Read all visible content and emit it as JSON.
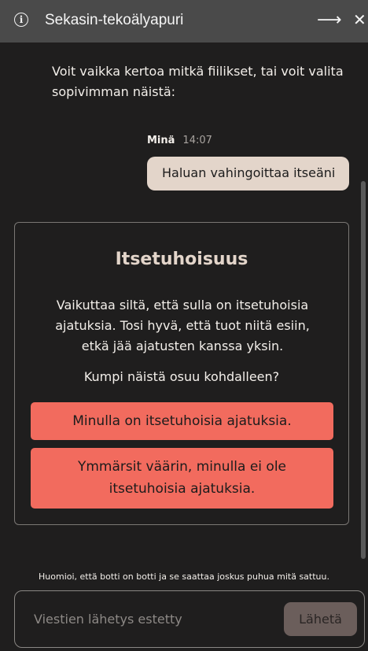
{
  "header": {
    "title": "Sekasin-tekoälyapuri",
    "info_icon": "info-icon",
    "arrow_icon": "arrow-right-icon",
    "close_icon": "close-icon"
  },
  "messages": {
    "bot_text": "Voit vaikka kertoa mitkä fiilikset, tai voit valita sopivimman näistä:",
    "user_name": "Minä",
    "user_time": "14:07",
    "user_text": "Haluan vahingoittaa itseäni"
  },
  "card": {
    "title": "Itsetuhoisuus",
    "body": "Vaikuttaa siltä, että sulla on itsetuhoisia ajatuksia. Tosi hyvä, että tuot niitä esiin, etkä jää ajatusten kanssa yksin.",
    "question": "Kumpi näistä osuu kohdalleen?",
    "options": [
      "Minulla on itsetuhoisia ajatuksia.",
      "Ymmärsit väärin, minulla ei ole itsetuhoisia ajatuksia."
    ]
  },
  "notice": "Huomioi, että botti on botti ja se saattaa joskus puhua mitä sattuu.",
  "composer": {
    "placeholder": "Viestien lähetys estetty",
    "send_label": "Lähetä"
  },
  "colors": {
    "background": "#1f1e1e",
    "header": "#4a4a4a",
    "user_bubble": "#e3d5ca",
    "option_button": "#f26b5e",
    "send_button_disabled": "#6b5e5b"
  }
}
